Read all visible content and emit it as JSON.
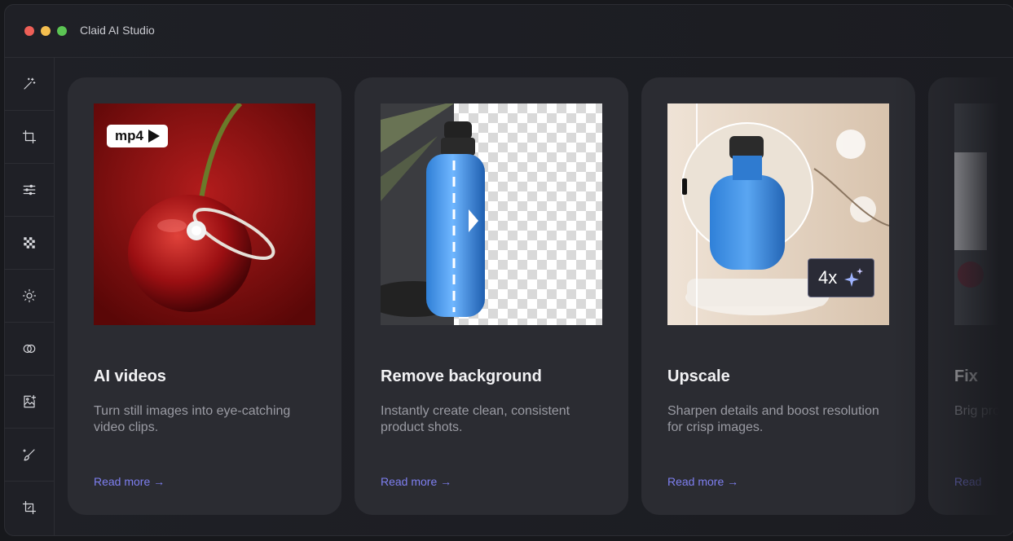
{
  "window": {
    "title": "Claid AI Studio"
  },
  "sidebar": {
    "items": [
      {
        "icon": "magic-wand-icon"
      },
      {
        "icon": "crop-icon"
      },
      {
        "icon": "sliders-icon"
      },
      {
        "icon": "checkerboard-icon"
      },
      {
        "icon": "brightness-icon"
      },
      {
        "icon": "toggle-icon"
      },
      {
        "icon": "image-add-icon"
      },
      {
        "icon": "brush-icon"
      },
      {
        "icon": "crop-alt-icon"
      }
    ]
  },
  "cards": [
    {
      "title": "AI videos",
      "description": "Turn still images into eye-catching video clips.",
      "link": "Read more →",
      "badge": "mp4"
    },
    {
      "title": "Remove background",
      "description": "Instantly create clean, consistent product shots.",
      "link": "Read more →"
    },
    {
      "title": "Upscale",
      "description": "Sharpen details and boost resolution for crisp images.",
      "link": "Read more →",
      "badge": "4x"
    },
    {
      "title": "Fix",
      "description": "Brig prof",
      "link": "Read"
    }
  ],
  "colors": {
    "accent": "#7e7ff0",
    "card": "#2b2c32",
    "background": "#1b1c21"
  }
}
